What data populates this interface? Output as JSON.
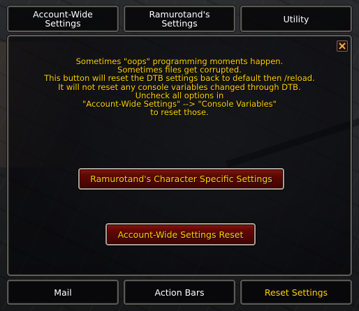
{
  "tabs_top": [
    {
      "line1": "Account-Wide",
      "line2": "Settings"
    },
    {
      "line1": "Ramurotand's",
      "line2": "Settings"
    },
    {
      "line1": "Utility",
      "line2": ""
    }
  ],
  "tabs_bottom": [
    {
      "label": "Mail"
    },
    {
      "label": "Action Bars"
    },
    {
      "label": "Reset Settings"
    }
  ],
  "message_lines": [
    "Sometimes \"oops\" programming moments happen.",
    "Sometimes files get corrupted.",
    "This button will reset the DTB settings back to default then /reload.",
    "It will not reset any console variables changed through DTB.",
    "Uncheck all options in",
    "\"Account-Wide Settings\" --> \"Console Variables\"",
    "to reset those."
  ],
  "buttons": {
    "character_reset": "Ramurotand's Character Specific Settings",
    "account_reset": "Account-Wide Settings Reset"
  },
  "icons": {
    "close": "close-icon"
  },
  "colors": {
    "text_gold": "#ffd100",
    "text_white": "#ffffff",
    "button_red": "#5a0602",
    "border_grey": "#5e5c58"
  }
}
